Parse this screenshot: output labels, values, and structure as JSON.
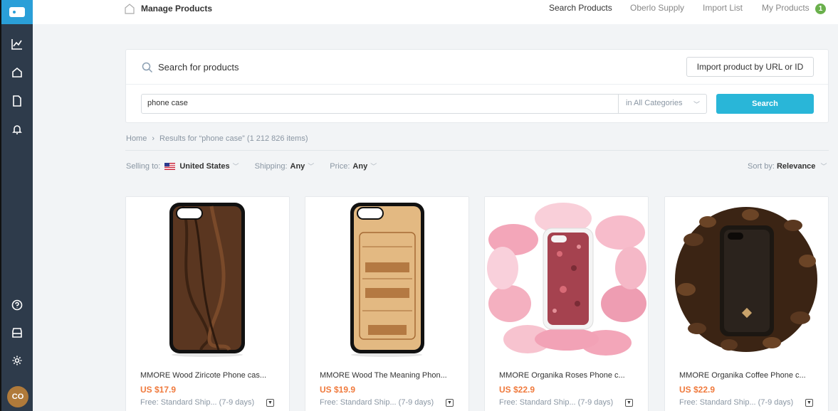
{
  "sidebar": {
    "logo_icon": "tag-icon",
    "top_icons": [
      "chart-icon",
      "home-icon",
      "document-icon",
      "bell-icon"
    ],
    "bottom_icons": [
      "help-icon",
      "store-icon",
      "gear-icon"
    ],
    "avatar_initials": "CO",
    "colors": {
      "background": "#2e3b4b",
      "logo": "#2a9fd8",
      "avatar": "#b07a3a"
    }
  },
  "header": {
    "page_title": "Manage Products",
    "nav": [
      "Search Products",
      "Oberlo Supply",
      "Import List",
      "My Products"
    ],
    "active_nav": "Search Products",
    "my_products_count": "1",
    "badge_color": "#6ab04c"
  },
  "search": {
    "heading": "Search for products",
    "import_button": "Import product by URL or ID",
    "query": "phone case",
    "category": "in All Categories",
    "button_label": "Search",
    "button_color": "#29b6d8"
  },
  "breadcrumb": {
    "home": "Home",
    "separator": "›",
    "results": "Results for “phone case” (1 212 826 items)"
  },
  "filters": {
    "selling_label": "Selling to:",
    "selling_value": "United States",
    "shipping_label": "Shipping:",
    "shipping_value": "Any",
    "price_label": "Price:",
    "price_value": "Any",
    "sort_label": "Sort by:",
    "sort_value": "Relevance"
  },
  "products": [
    {
      "title": "MMORE Wood Ziricote Phone cas...",
      "price": "US $17.9",
      "shipping": "Free: Standard Ship... (7-9 days)"
    },
    {
      "title": "MMORE Wood The Meaning Phon...",
      "price": "US $19.9",
      "shipping": "Free: Standard Ship... (7-9 days)"
    },
    {
      "title": "MMORE Organika Roses Phone c...",
      "price": "US $22.9",
      "shipping": "Free: Standard Ship... (7-9 days)"
    },
    {
      "title": "MMORE Organika Coffee Phone c...",
      "price": "US $22.9",
      "shipping": "Free: Standard Ship... (7-9 days)"
    }
  ],
  "price_color": "#f07a3d"
}
